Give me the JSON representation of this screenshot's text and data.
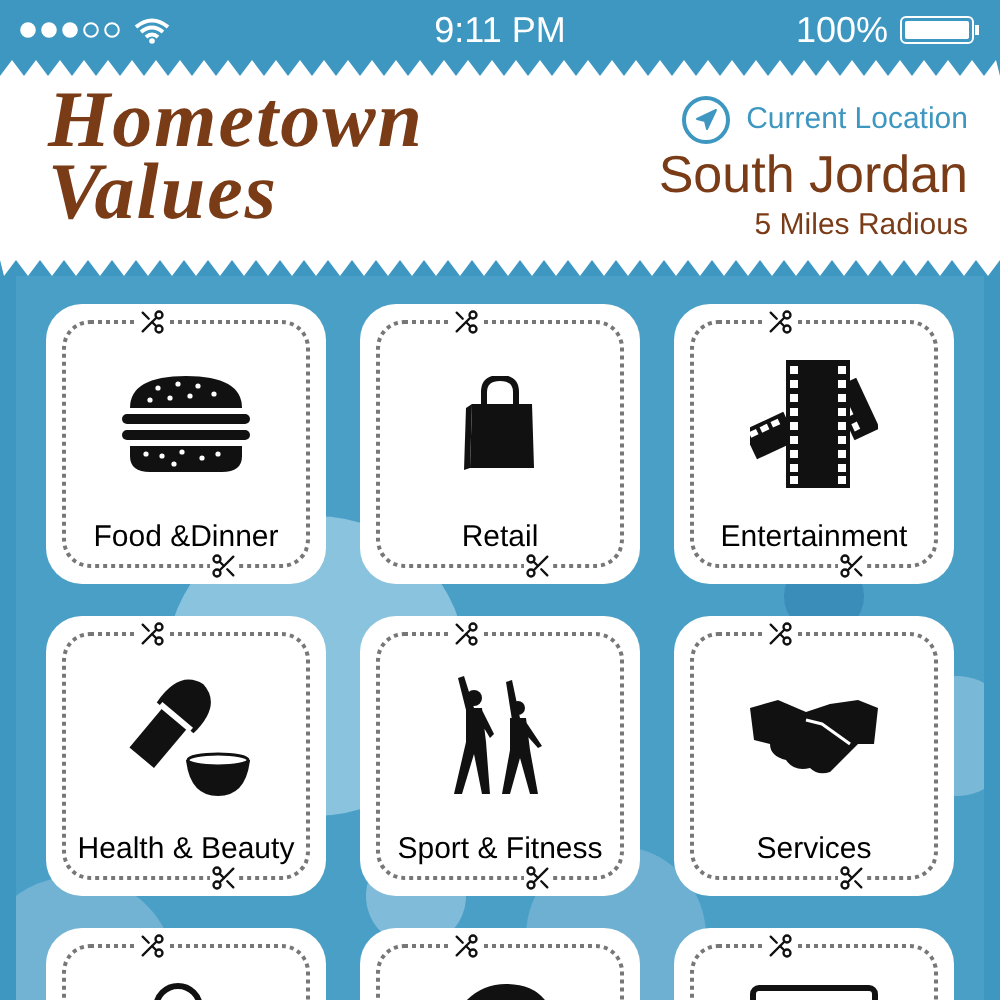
{
  "status_bar": {
    "time": "9:11 PM",
    "battery": "100%"
  },
  "header": {
    "logo_line_1": "Hometown",
    "logo_line_2": "Values",
    "location_link": "Current Location",
    "city": "South Jordan",
    "radius": "5 Miles Radious"
  },
  "categories": [
    {
      "kind": "labeled",
      "label": "Food &Dinner"
    },
    {
      "kind": "labeled",
      "label": "Retail"
    },
    {
      "kind": "labeled",
      "label": "Entertainment"
    },
    {
      "kind": "labeled",
      "label": "Health & Beauty"
    },
    {
      "kind": "labeled",
      "label": "Sport & Fitness"
    },
    {
      "kind": "labeled",
      "label": "Services"
    },
    {
      "kind": "cut_off"
    },
    {
      "kind": "cut_off"
    },
    {
      "kind": "cut_off"
    }
  ]
}
